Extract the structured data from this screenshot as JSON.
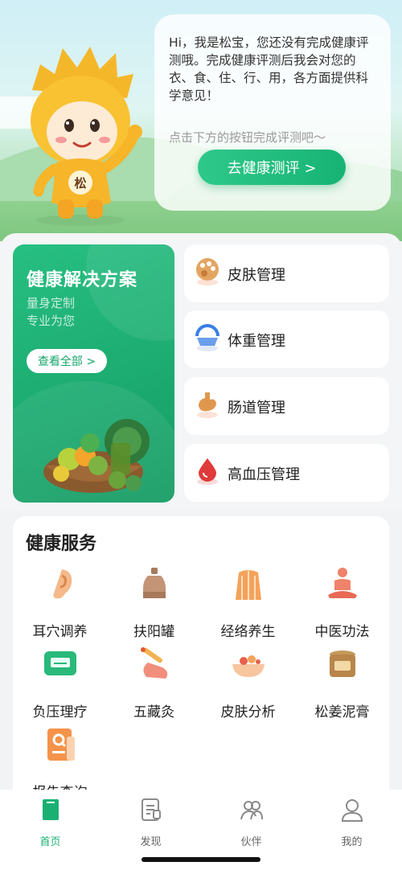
{
  "hero": {
    "bubble_text": "Hi，我是松宝，您还没有完成健康评测哦。完成健康评测后我会对您的衣、食、住、行、用，各方面提供科学意见！",
    "hint": "点击下方的按钮完成评测吧～",
    "button_label": "去健康测评 >",
    "mascot_badge": "松"
  },
  "solutions": {
    "title": "健康解决方案",
    "subtitle1": "量身定制",
    "subtitle2": "专业为您",
    "view_all": "查看全部 >"
  },
  "management": [
    {
      "label": "皮肤管理",
      "icon": "palette-icon"
    },
    {
      "label": "体重管理",
      "icon": "scale-icon"
    },
    {
      "label": "肠道管理",
      "icon": "stomach-icon"
    },
    {
      "label": "高血压管理",
      "icon": "blood-drop-icon"
    }
  ],
  "services": {
    "title": "健康服务",
    "items": [
      {
        "label": "耳穴调养",
        "icon": "ear-icon"
      },
      {
        "label": "扶阳罐",
        "icon": "cupping-jar-icon"
      },
      {
        "label": "经络养生",
        "icon": "meridian-body-icon"
      },
      {
        "label": "中医功法",
        "icon": "meditation-icon"
      },
      {
        "label": "负压理疗",
        "icon": "device-icon"
      },
      {
        "label": "五藏灸",
        "icon": "moxibustion-icon"
      },
      {
        "label": "皮肤分析",
        "icon": "skin-bowl-icon"
      },
      {
        "label": "松姜泥膏",
        "icon": "jar-icon"
      },
      {
        "label": "报告查询",
        "icon": "report-search-icon"
      }
    ]
  },
  "tabs": [
    {
      "label": "首页",
      "icon": "home-icon",
      "active": true
    },
    {
      "label": "发现",
      "icon": "discover-icon",
      "active": false
    },
    {
      "label": "伙伴",
      "icon": "partner-icon",
      "active": false
    },
    {
      "label": "我的",
      "icon": "profile-icon",
      "active": false
    }
  ],
  "colors": {
    "accent": "#1bb073",
    "card_green": "#1fae71"
  }
}
